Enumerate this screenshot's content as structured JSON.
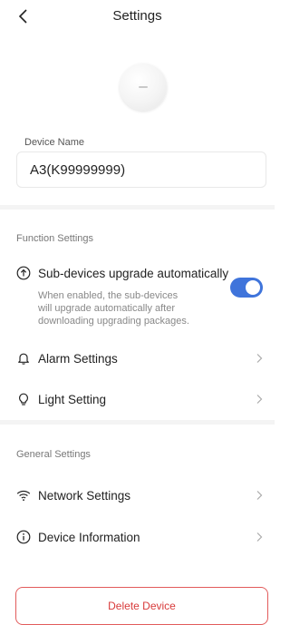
{
  "header": {
    "title": "Settings"
  },
  "device": {
    "name_label": "Device Name",
    "name_value": "A3(K99999999)"
  },
  "function_settings": {
    "section_title": "Function Settings",
    "subdevice_upgrade": {
      "label": "Sub-devices upgrade automatically",
      "description_lines": [
        "When enabled, the sub-devices",
        "will upgrade automatically after",
        "downloading upgrading packages."
      ],
      "enabled": true
    },
    "alarm_settings_label": "Alarm Settings",
    "light_setting_label": "Light Setting"
  },
  "general_settings": {
    "section_title": "General Settings",
    "network_settings_label": "Network Settings",
    "device_information_label": "Device Information"
  },
  "actions": {
    "delete_label": "Delete Device"
  },
  "colors": {
    "accent": "#3f74db",
    "danger": "#d83a3a"
  }
}
